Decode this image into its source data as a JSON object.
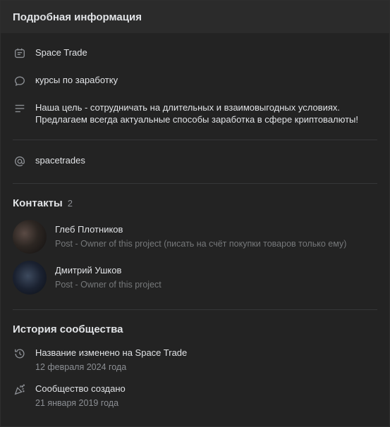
{
  "header": {
    "title": "Подробная информация"
  },
  "info": {
    "name": "Space Trade",
    "status": "курсы по заработку",
    "description_line1": "Наша цель - сотрудничать на длительных и взаимовыгодных условиях.",
    "description_line2": "Предлагаем всегда актуальные способы заработка в сфере криптовалюты!",
    "domain": "spacetrades"
  },
  "contacts": {
    "title": "Контакты",
    "count": "2",
    "items": [
      {
        "name": "Глеб Плотников",
        "role": "Post - Owner of this project (писать на счёт покупки товаров только ему)"
      },
      {
        "name": "Дмитрий Ушков",
        "role": "Post - Owner of this project"
      }
    ]
  },
  "history": {
    "title": "История сообщества",
    "items": [
      {
        "title": "Название изменено на Space Trade",
        "date": "12 февраля 2024 года",
        "icon": "history-icon"
      },
      {
        "title": "Сообщество создано",
        "date": "21 января 2019 года",
        "icon": "party-popper-icon"
      }
    ]
  },
  "colors": {
    "background": "#232323",
    "header": "#2b2b2b",
    "text": "#e1e3e6",
    "muted": "#8c8f94"
  }
}
